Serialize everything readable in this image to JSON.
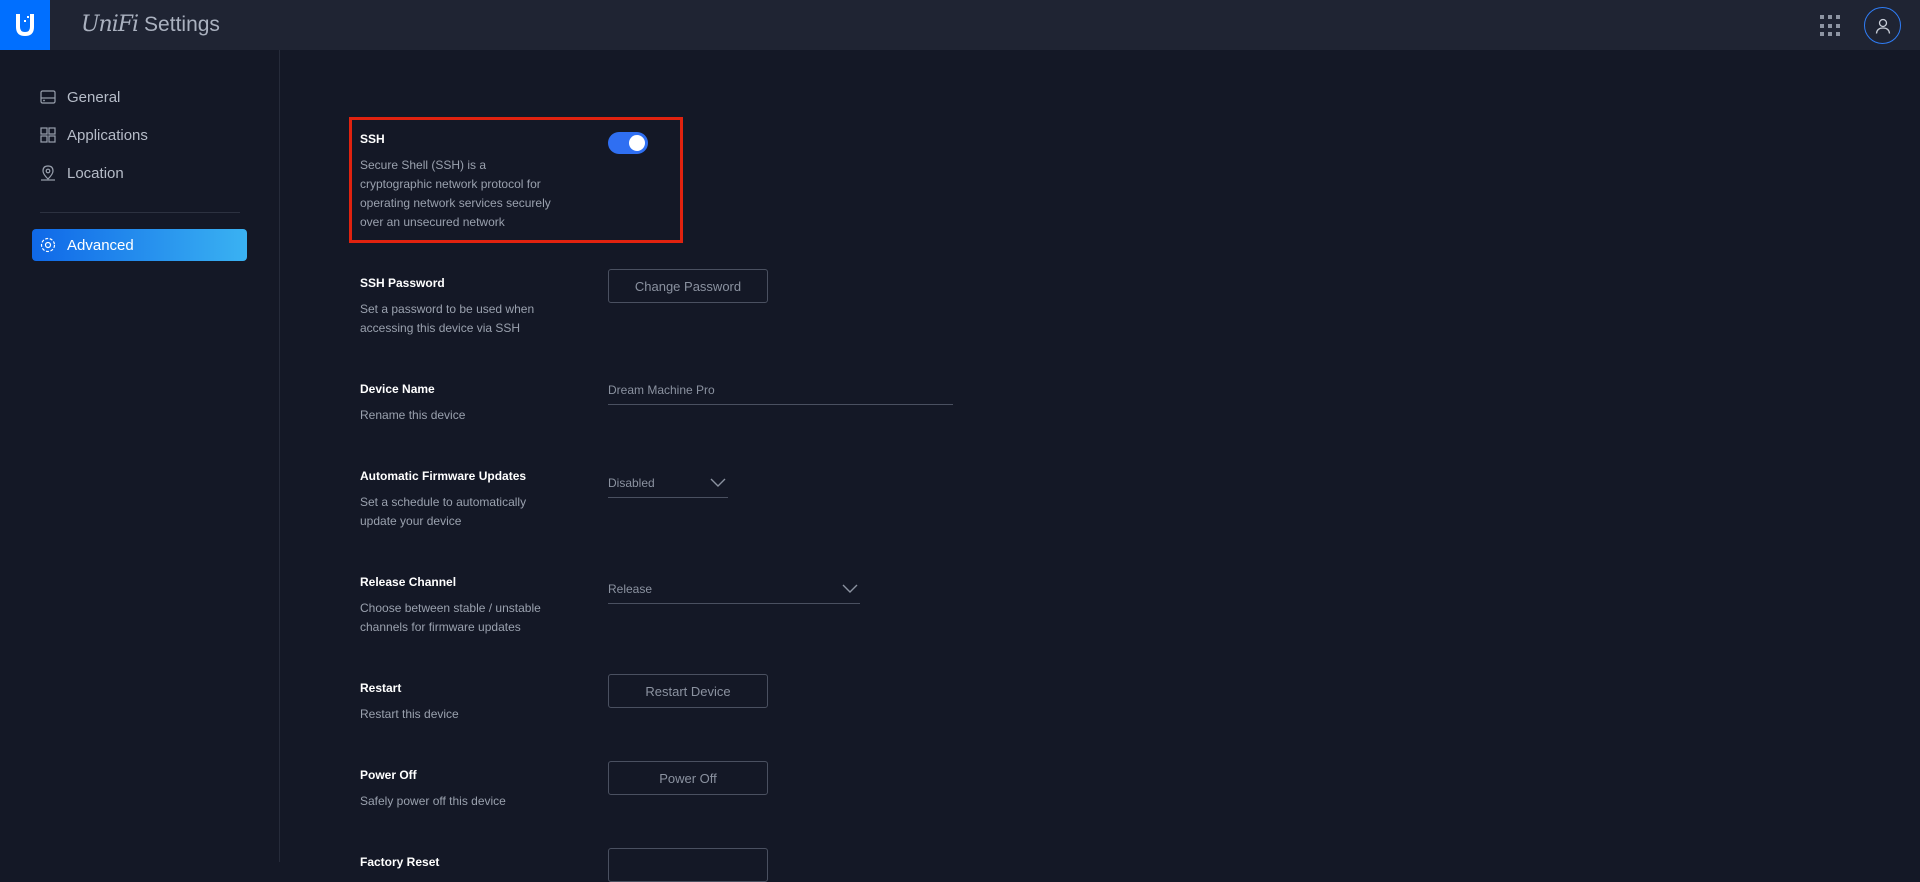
{
  "header": {
    "brand_name": "UniFi",
    "app_name": "Settings"
  },
  "sidebar": {
    "items": [
      {
        "label": "General",
        "icon": "drive-icon"
      },
      {
        "label": "Applications",
        "icon": "grid-icon"
      },
      {
        "label": "Location",
        "icon": "location-icon"
      },
      {
        "label": "Advanced",
        "icon": "gear-icon",
        "active": true
      }
    ]
  },
  "settings": {
    "ssh": {
      "title": "SSH",
      "description": "Secure Shell (SSH) is a cryptographic network protocol for operating network services securely over an unsecured network",
      "enabled": true
    },
    "ssh_password": {
      "title": "SSH Password",
      "description": "Set a password to be used when accessing this device via SSH",
      "button_label": "Change Password"
    },
    "device_name": {
      "title": "Device Name",
      "description": "Rename this device",
      "placeholder": "Dream Machine Pro"
    },
    "firmware_updates": {
      "title": "Automatic Firmware Updates",
      "description": "Set a schedule to automatically update your device",
      "selected": "Disabled"
    },
    "release_channel": {
      "title": "Release Channel",
      "description": "Choose between stable / unstable channels for firmware updates",
      "selected": "Release"
    },
    "restart": {
      "title": "Restart",
      "description": "Restart this device",
      "button_label": "Restart Device"
    },
    "power_off": {
      "title": "Power Off",
      "description": "Safely power off this device",
      "button_label": "Power Off"
    },
    "factory_reset": {
      "title": "Factory Reset"
    }
  },
  "colors": {
    "accent": "#006fff",
    "highlight_border": "#e0220f",
    "background": "#141826",
    "topbar": "#1f2433"
  }
}
